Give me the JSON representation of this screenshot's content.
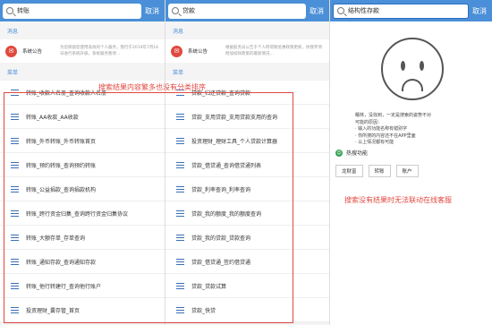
{
  "screen1": {
    "search_value": "转账",
    "cancel": "取消",
    "section_message": "消息",
    "notice_title": "系统公告",
    "notice_text": "为您保留您使用高效的个人服务，我行于2019年7月14日进行系统升级，系统服务暂停…",
    "section_menu": "菜单",
    "items": [
      "转账_收款人名册_查询收款人名册",
      "转账_AA收款_AA收款",
      "转账_外币转账_外币转账首页",
      "转账_预约转账_查询预约转账",
      "转账_公益捐款_查询捐款机构",
      "转账_跨行资金归集_查询跨行资金归集协议",
      "转账_大额存单_存单查询",
      "转账_通知存款_查询通知存款",
      "转账_他行转建行_查询他行账户",
      "投资理财_囊存管_首页"
    ]
  },
  "screen2": {
    "search_value": "贷款",
    "cancel": "取消",
    "section_message": "消息",
    "notice_title": "系统公告",
    "notice_text": "根据股务员公告于个人所得税优惠政策更新，你我专项附加扣除政策的最新情况…",
    "section_menu": "菜单",
    "items": [
      "贷款_归还贷款_查询贷款",
      "贷款_支用贷款_支用贷款支用的查询",
      "投资理财_理财工具_个人贷款计算器",
      "贷款_借贷通_查询借贷通列表",
      "贷款_利率查询_利率查询",
      "贷款_我的额度_我的额度查询",
      "贷款_我的贷款_贷款查询",
      "贷款_借贷通_签约借贷通",
      "贷款_贷款试算",
      "贷款_快贷"
    ]
  },
  "screen3": {
    "search_value": "结构性存款",
    "cancel": "取消",
    "empty_lines": [
      "糯林，没找到，一定是搜索的姿势不对",
      "可能的原因：",
      "· 输入的功能名称有错别字",
      "· 你所搜的内容还不在APP里面",
      "· 以上情况都有可能"
    ],
    "hot_label": "热搜功能",
    "chips": [
      "龙财富",
      "转账",
      "账户"
    ]
  },
  "annotations": {
    "left": "搜索结果内容繁多也没有分类排序",
    "right": "搜索没有结果时无法联动在线客服"
  },
  "colors": {
    "accent": "#4a8fd7",
    "annotation": "#e0493f"
  }
}
